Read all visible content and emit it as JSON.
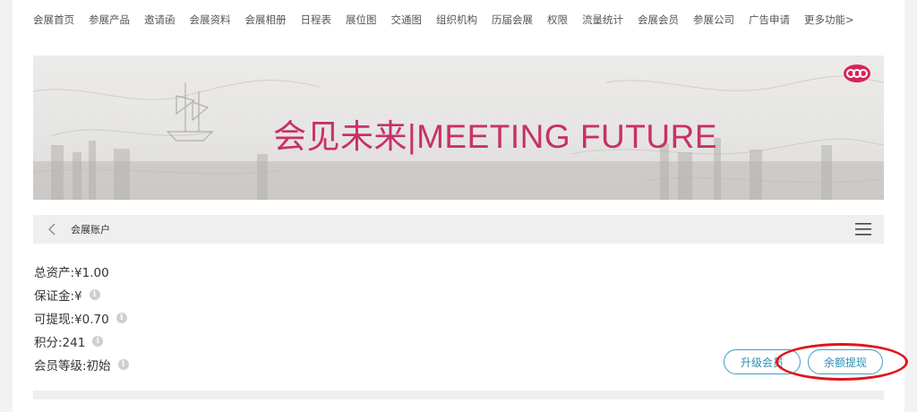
{
  "nav": {
    "items": [
      "会展首页",
      "参展产品",
      "邀请函",
      "会展资料",
      "会展相册",
      "日程表",
      "展位图",
      "交通图",
      "组织机构",
      "历届会展",
      "权限",
      "流量统计",
      "会展会员",
      "参展公司",
      "广告申请",
      "更多功能>"
    ]
  },
  "banner": {
    "title": "会见未来|MEETING FUTURE",
    "logo_icon": "brand-logo-icon",
    "accent": "#c8306a"
  },
  "breadcrumb": {
    "title": "会展账户",
    "back_icon": "chevron-left-icon",
    "menu_icon": "hamburger-menu-icon"
  },
  "account": {
    "total_assets": "总资产:¥1.00",
    "deposit": "保证金:¥",
    "withdrawable": "可提现:¥0.70",
    "points": "积分:241",
    "member_level": "会员等级:初始"
  },
  "actions": {
    "upgrade_label": "升级会员",
    "withdraw_label": "余额提现"
  },
  "colors": {
    "button_border": "#3aa0c4",
    "highlight": "#e0151a"
  }
}
